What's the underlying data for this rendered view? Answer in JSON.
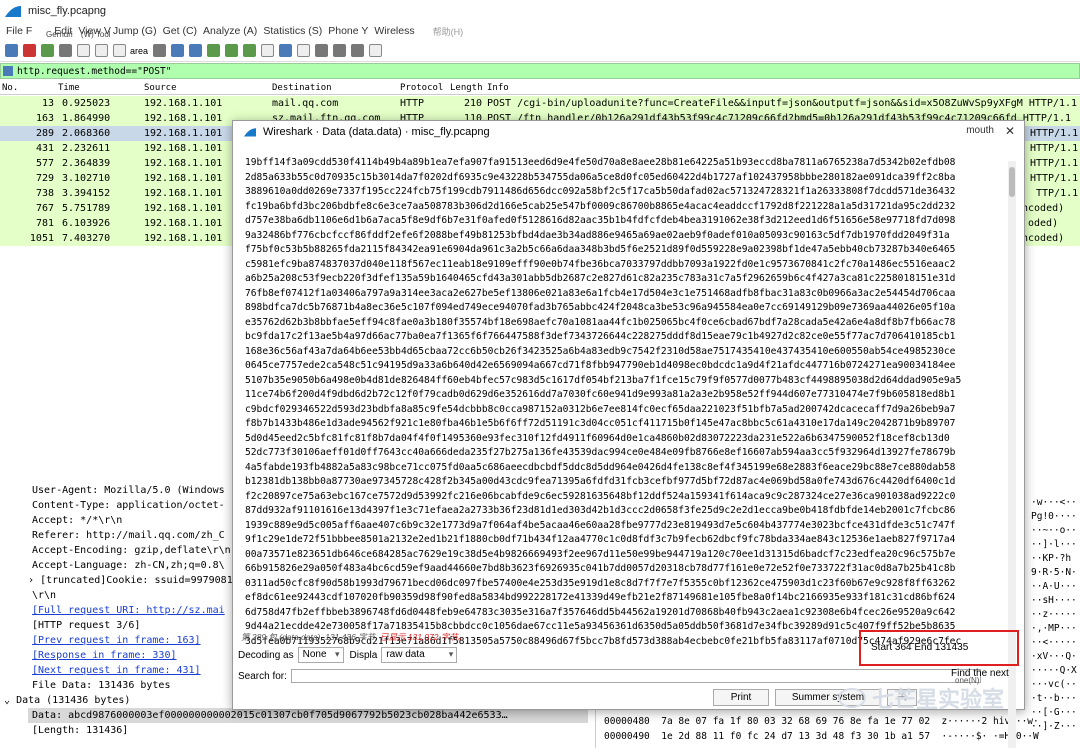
{
  "window": {
    "title": "misc_fly.pcapng"
  },
  "menu": [
    "File F",
    "Edit",
    "View V",
    "Jump (G)",
    "Get (C)",
    "Analyze (A)",
    "Statistics (S)",
    "Phone Y",
    "Wireless",
    "帮助(H)"
  ],
  "menu_overlay": [
    "Gerhuri",
    "(W) Tool",
    "Edit"
  ],
  "toolbar": {
    "area_label": "area"
  },
  "filter": {
    "value": "http.request.method==\"POST\""
  },
  "packet_list": {
    "columns": [
      "No.",
      "Time",
      "Source",
      "Destination",
      "Protocol",
      "Length",
      "Info"
    ],
    "rows": [
      {
        "no": "13",
        "time": "0.925023",
        "src": "192.168.1.101",
        "dst": "mail.qq.com",
        "proto": "HTTP",
        "len": "210",
        "info": "POST /cgi-bin/uploadunite?func=CreateFile&&inputf=json&outputf=json&&sid=x5O8ZuWvSp9yXFgM HTTP/1.1"
      },
      {
        "no": "163",
        "time": "1.864990",
        "src": "192.168.1.101",
        "dst": "sz.mail.ftn.qq.com",
        "proto": "HTTP",
        "len": "110",
        "info": "POST /ftn_handler/0b126a291df43b53f99c4c71209c66fd?bmd5=0b126a291df43b53f99c4c71209c66fd HTTP/1.1"
      },
      {
        "no": "289",
        "time": "2.068360",
        "src": "192.168.1.101",
        "dst": "",
        "proto": "",
        "len": "",
        "info": "HTTP/1.1"
      },
      {
        "no": "431",
        "time": "2.232611",
        "src": "192.168.1.101",
        "dst": "",
        "proto": "",
        "len": "",
        "info": "HTTP/1.1"
      },
      {
        "no": "577",
        "time": "2.364839",
        "src": "192.168.1.101",
        "dst": "",
        "proto": "",
        "len": "",
        "info": "HTTP/1.1"
      },
      {
        "no": "729",
        "time": "3.102710",
        "src": "192.168.1.101",
        "dst": "",
        "proto": "",
        "len": "",
        "info": "HTTP/1.1"
      },
      {
        "no": "738",
        "time": "3.394152",
        "src": "192.168.1.101",
        "dst": "",
        "proto": "",
        "len": "",
        "info": "TTP/1.1"
      },
      {
        "no": "767",
        "time": "5.751789",
        "src": "192.168.1.101",
        "dst": "",
        "proto": "",
        "len": "",
        "info": "ncoded)"
      },
      {
        "no": "781",
        "time": "6.103926",
        "src": "192.168.1.101",
        "dst": "",
        "proto": "",
        "len": "",
        "info": "oded)"
      },
      {
        "no": "1051",
        "time": "7.403270",
        "src": "192.168.1.101",
        "dst": "",
        "proto": "",
        "len": "",
        "info": "ncoded)"
      }
    ]
  },
  "detail": {
    "rows": [
      {
        "text": "User-Agent: Mozilla/5.0 (Windows",
        "link": false
      },
      {
        "text": "Content-Type: application/octet-",
        "link": false
      },
      {
        "text": "Accept: */*\\r\\n",
        "link": false
      },
      {
        "text": "Referer: http://mail.qq.com/zh_C",
        "link": false
      },
      {
        "text": "Accept-Encoding: gzip,deflate\\r\\n",
        "link": false
      },
      {
        "text": "Accept-Language: zh-CN,zh;q=0.8\\",
        "link": false
      },
      {
        "text": "[truncated]Cookie: ssuid=9979081",
        "link": false
      },
      {
        "text": "\\r\\n",
        "link": false
      },
      {
        "text": "[Full request URI: http://sz.mai",
        "link": true
      },
      {
        "text": "[HTTP request 3/6]",
        "link": false
      },
      {
        "text": "[Prev request in frame: 163]",
        "link": true
      },
      {
        "text": "[Response in frame: 330]",
        "link": true
      },
      {
        "text": "[Next request in frame: 431]",
        "link": true
      },
      {
        "text": "File Data: 131436 bytes",
        "link": false
      },
      {
        "text": "Data (131436 bytes)",
        "link": false
      },
      {
        "text": "Data: abcd9876000003ef000000000002015c01307cb0f705d9067792b5023cb028ba442e6533…",
        "link": false
      },
      {
        "text": "[Length: 131436]",
        "link": false
      }
    ]
  },
  "hex": {
    "rows": [
      {
        "off": "00000480",
        "bytes": "7a 8e 07 fa 1f 80 03 32   68 69 76 8e fa 1e 77 02",
        "ascii": "z······2 hiv···w·"
      },
      {
        "off": "00000490",
        "bytes": "1e 2d 88 11 f0 fc 24 d7   13 3d 48 f3 30 1b a1 57",
        "ascii": "·-····$· ·=H·0··W"
      }
    ],
    "ascii_side": [
      "·w···<··",
      "Pg!0····",
      "··~··o··",
      "··]·l···",
      "··KP·?h",
      "9·R·5·N·",
      "··A·U···",
      "··sH····",
      "··z·····",
      "·,·MP···",
      "··<·····",
      "·xV···Q·",
      "·····Q·X",
      "···vc(··",
      "·t··b···",
      "··[·G···",
      "··]·Z···"
    ]
  },
  "dialog": {
    "title": "Wireshark · Data (data.data) · misc_fly.pcapng",
    "mouth": "mouth",
    "close": "✕",
    "hex_lines": [
      "19bff14f3a09cdd530f4114b49b4a89b1ea7efa907fa91513eed6d9e4fe50d70a8e8aee28b81e64225a51b93eccd8ba7811a6765238a7d5342b02efdb08",
      "2d85a633b55c0d70935c15b3014da7f0202df6935c9e43228b534755da06a5ce8d0fc05ed60422d4b1727af102437958bbbe280182ae091dca39ff2c8ba",
      "3889610a0dd0269e7337f195cc224fcb75f199cdb7911486d656dcc092a58bf2c5f17ca5b50dafad02ac571324728321f1a26333808f7dcdd571de36432",
      "fc19ba6bfd3bc206bdbfe8c6e3ce7aa508783b306d2d166e5cab25e547bf0009c86700b8865e4acac4eaddccf1792d8f221228a1a5d31721da95c2dd232",
      "d757e38ba6db1106e6d1b6a7aca5f8e9df6b7e31f0afed0f5128616d82aac35b1b4fdfcfdeb4bea3191062e38f3d212eed1d6f51656e58e97718fd7d098",
      "9a32486bf776cbcfccf86fddf2efe6f2088bef49b81253bfbd4dae3b34ad886e9465a69ae02aeb9f0adef010a05093c90163c5df7db1970fdd2049f31a",
      "f75bf0c53b5b88265fda2115f84342ea91e6904da961c3a2b5c66a6daa348b3bd5f6e2521d89f0d559228e9a02398bf1de47a5ebb40cb73287b340e6465",
      "c5981efc9ba874837037d040e118f567ec11eab18e9109efff90e0b74fbe36bca7033797ddbb7093a1922fd0e1c9573670841c2fc70a1486ec5516eaac2",
      "a6b25a208c53f9ecb220f3dfef135a59b1640465cfd43a301abb5db2687c2e827d61c82a235c783a31c7a5f2962659b6c4f427a3ca81c2258018151e31d",
      "76fb8ef07412f1a03406a797a9a314ee3aca2e627be5ef13806e021a83e6a1fcb4e17d504e3c1e751468adfb8fbac31a83c0b0966a3ac2e54454d706caa",
      "898bdfca7dc5b76871b4a8ec36e5c107f094ed749ece94070fad3b765abbc424f2048ca3be53c96a945584ea0e7cc69149129b09e7369aa44026e05f10a",
      "e35762d62b3b8bbfae5eff94c8fae0a3b180f35574bf18e698aefc70a1081aa44fc1b025065bc4f0ce6cbad67bdf7a28cada5e42a6e4a8df8b7fb66ac78",
      "bc9fda17c2f13ae5b4a97d66ac77ba0ea7f1365f6f766447588f3def7343726644c228275dddf8d15eae79c1b4927d2c82ce0e55f77ac7d706410185cb1",
      "168e36c56af43a7da64b6ee53bb4d65cbaa72cc6b50cb26f3423525a6b4a83edb9c7542f2310d58ae7517435410e437435410e600550ab54ce4985230ce",
      "0645ce7757ede2ca548c51c94195d9a33a6b640d42e6569094a667cd71f8fbb947790eb1d4098ec0bdcdc1a9d4f21afdc447716b0724271ea90034184ee",
      "5107b35e9050b6a498e0b4d81de826484ff60eb4bfec57c983d5c1617df054bf213ba7f1fce15c79f9f0577d0077b483cf4498895038d2d64ddad905e9a5",
      "11ce74b6f200d4f9dbd6d2b72c12f0f79cadb0d629d6e352616dd7a7030fc60e941d9e993a81a2a3e2b958e52ff944d607e77310474e7f9b605818ed8b1",
      "c9bdcf029346522d593d23bdbfa8a85c9fe54dcbbb8c0cca987152a0312b6e7ee814fc0ecf65daa221023f51bfb7a5ad200742dcacecaff7d9a26beb9a7",
      "f8b7b1433b486e1d3ade94562f921c1e80fba46b1e5b6f6ff72d51191c3d04cc051cf411715b0f145e47ac8bbc5c61a4310e17da149c2042871b9b89707",
      "5d0d45eed2c5bfc81fc81f8b7da04f4f0f1495360e93fec310f12fd4911f60964d0e1ca4860b02d83072223da231e522a6b6347590052f18cef8cb13d0",
      "52dc773f30106aeff01d0ff7643cc40a666deda235f27b275a136fe43539dac994ce0e484e09fb8766e8ef16607ab594aa3cc5f932964d13927fe78679b",
      "4a5fabde193fb4882a5a83c98bce71cc075fd0aa5c686aeecdbcbdf5ddc8d5dd964e0426d4fe138c8ef4f345199e68e2883f6eace29bc88e7ce880dab58",
      "b12381db138bb0a87730ae97345728c428f2b345a00d43cdc9fea71395a6fdfd31fcb3cefbf977d5bf72d87ac4e069bd58a0fe743d676c4420df6400c1d",
      "f2c20897ce75a63ebc167ce7572d9d53992fc216e06bcabfde9c6ec59281635648bf12ddf524a159341f614aca9c9c287324ce27e36ca901038ad9222c0",
      "87dd932af91101616e13d4397f1e3c71efaea2a2733b36f23d81d1ed303d42b1d3ccc2d0658f3fe25d9c2e2d1ecca9be0b418fdbfde14eb2001c7fcbc86",
      "1939c889e9d5c005aff6aae407c6b9c32e1773d9a7f064af4be5acaa46e60aa28fbe9777d23e819493d7e5c604b437774e3023bcfce431dfde3c51c747f",
      "9f1c29e1de72f51bbbee8501a2132e2ed1b21f1880cb0df71b434f12aa4770c1c0d8fdf3c7b9fecb62dbcf9fc78bda334ae843c12536e1aeb827f9717a4",
      "00a73571e823651db646ce684285ac7629e19c38d5e4b9826669493f2ee967d11e50e99be944719a120c70ee1d31315d6badcf7c23edfea20c96c575b7e",
      "66b915826e29a050f483a4bc6cd59ef9aad44660e7bd8b3623f6926935c041b7dd0057d20318cb78d77f161e0e72e52f0e733722f31ac0d8a7b25b41c8b",
      "0311ad50cfc8f90d58b1993d79671becd06dc097fbe57400e4e253d35e919d1e8c8d7f7f7e7f5355c0bf12362ce475903d1c23f60b67e9c928f8ff63262",
      "ef8dc61ee92443cdf107020fb90359d98f90fed8a5834bd992228172e41339d49efb21e2f87149681e105fbe8a0f14bc2166935e933f181c31cd86bf624",
      "6d758d47fb2effbbeb3896748fd6d0448feb9e64783c3035e316a7f357646dd5b44562a19201d70868b40fb943c2aea1c92308e6b4fcec26e9520a9c642",
      "9d44a21ecdde42e730058f17a71835415b8cbbdcc0c1056dae67cc11e5a93456361d6350d5a05ddb50f3681d7e34fbc39289d91c5c407f9ff52be5b8635",
      "3d5fea0b7119352768b9cd21f13e71a86d1f5813505a5750c88496d67f5bcc7b8fd573d388ab4ecbebc0fe21bfb5fa83117af0710d75c474af929e6c7fec"
    ],
    "status_text": "第 289 包 (data.data), 131,436 字节.",
    "status_red": "已显示 131,072 字节。",
    "decoding_label": "Decoding as",
    "decoding_value": "None",
    "display_label": "Displa",
    "display_value": "raw data",
    "start_end": "Start 364 End 131435",
    "search_label": "Search for:",
    "find_next": "Find the next",
    "find_next_sub": "one(N)",
    "print_label": "Print",
    "summer_label": "Summer system",
    "close_label": "关"
  },
  "watermark": {
    "text": "七芒星实验室"
  },
  "colors": {
    "green_row": "#e4ffc7",
    "filter_bg": "#afffaf",
    "selected_row": "#c8d8e8",
    "highlight_box": "#e02020",
    "link": "#1a3ed6"
  }
}
